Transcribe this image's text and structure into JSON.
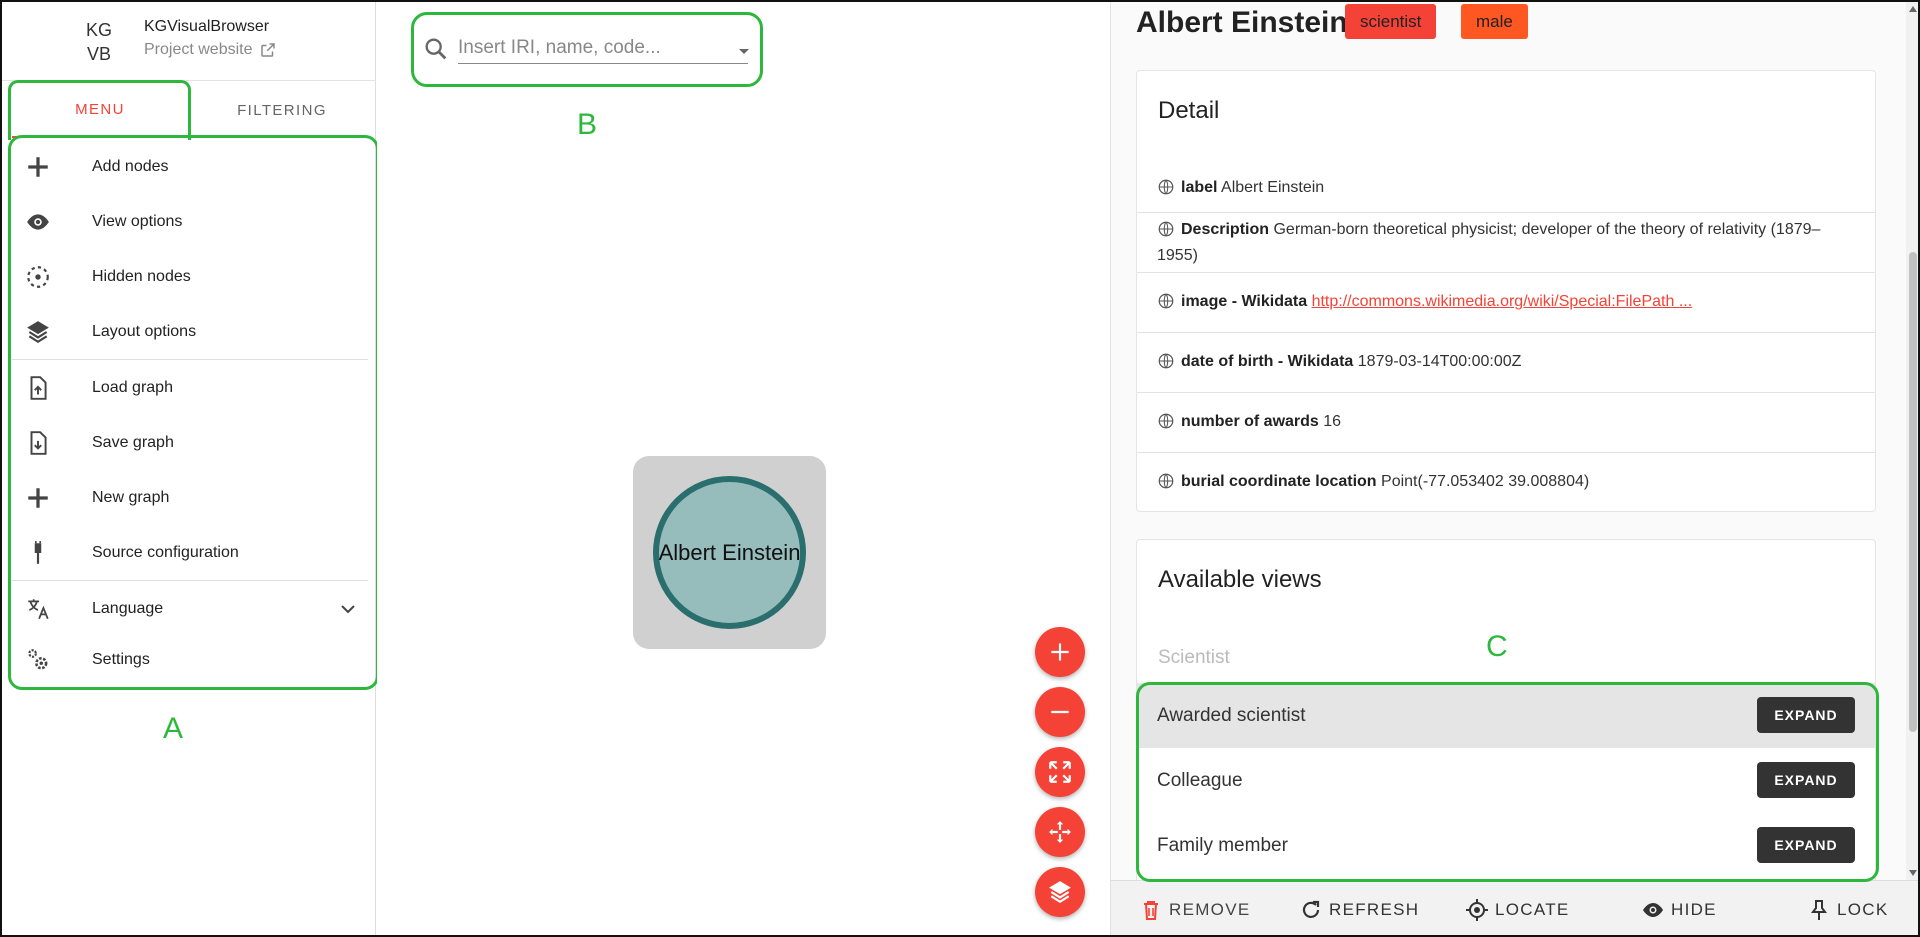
{
  "brand": {
    "logo_line1": "KG",
    "logo_line2": "VB",
    "name": "KGVisualBrowser",
    "link": "Project website"
  },
  "tabs": {
    "menu": "MENU",
    "filtering": "FILTERING"
  },
  "menu": [
    {
      "label": "Add nodes",
      "icon": "plus-icon"
    },
    {
      "label": "View options",
      "icon": "eye-icon"
    },
    {
      "label": "Hidden nodes",
      "icon": "dashed-circle-icon"
    },
    {
      "label": "Layout options",
      "icon": "layers-icon"
    },
    {
      "label": "Load graph",
      "icon": "file-upload-icon"
    },
    {
      "label": "Save graph",
      "icon": "file-download-icon"
    },
    {
      "label": "New graph",
      "icon": "plus-icon"
    },
    {
      "label": "Source configuration",
      "icon": "plug-icon"
    },
    {
      "label": "Language",
      "icon": "translate-icon"
    },
    {
      "label": "Settings",
      "icon": "cogs-icon"
    }
  ],
  "annotations": {
    "a": "A",
    "b": "B",
    "c": "C"
  },
  "search": {
    "placeholder": "Insert IRI, name, code..."
  },
  "graph": {
    "node_label": "Albert Einstein"
  },
  "entity": {
    "title": "Albert Einstein",
    "badges": [
      "scientist",
      "male"
    ],
    "detail_title": "Detail",
    "properties": [
      {
        "name": "label",
        "value": "Albert Einstein"
      },
      {
        "name": "Description",
        "value": "German-born theoretical physicist; developer of the theory of relativity (1879–1955)"
      },
      {
        "name": "image - Wikidata",
        "value": "http://commons.wikimedia.org/wiki/Special:FilePath ..."
      },
      {
        "name": "date of birth - Wikidata",
        "value": "1879-03-14T00:00:00Z"
      },
      {
        "name": "number of awards",
        "value": "16"
      },
      {
        "name": "burial coordinate location",
        "value": "Point(-77.053402 39.008804)"
      }
    ],
    "views_title": "Available views",
    "views_category": "Scientist",
    "views": [
      {
        "label": "Awarded scientist",
        "button": "EXPAND"
      },
      {
        "label": "Colleague",
        "button": "EXPAND"
      },
      {
        "label": "Family member",
        "button": "EXPAND"
      }
    ]
  },
  "actions": {
    "remove": "REMOVE",
    "refresh": "REFRESH",
    "locate": "LOCATE",
    "hide": "HIDE",
    "lock": "LOCK"
  },
  "colors": {
    "accent": "#f44336",
    "annotation": "#2db83d",
    "node_fill": "#96bcbc",
    "node_border": "#2a6e6e"
  }
}
